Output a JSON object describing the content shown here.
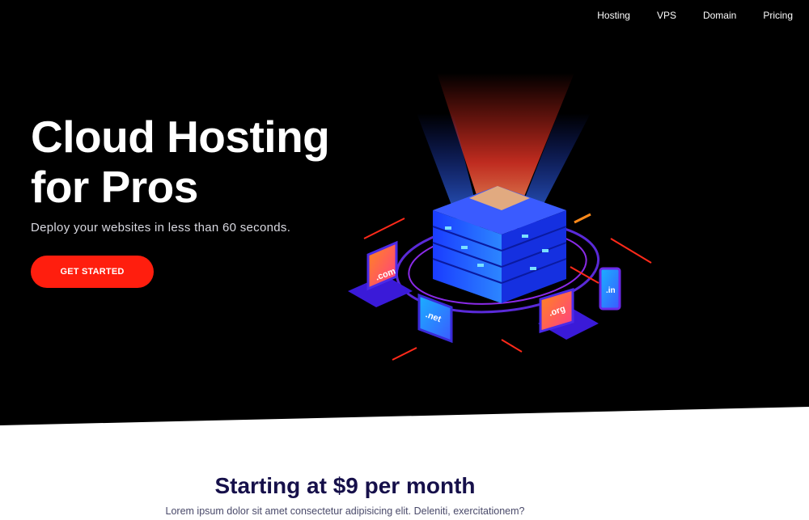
{
  "nav": {
    "items": [
      {
        "label": "Hosting"
      },
      {
        "label": "VPS"
      },
      {
        "label": "Domain"
      },
      {
        "label": "Pricing"
      }
    ]
  },
  "hero": {
    "title_line1": "Cloud Hosting",
    "title_line2": "for Pros",
    "subtitle": "Deploy your websites in less than 60 seconds.",
    "cta_label": "GET STARTED"
  },
  "illustration": {
    "domains": [
      ".com",
      ".net",
      ".org",
      ".in"
    ]
  },
  "pricing": {
    "title": "Starting at $9 per month",
    "description": "Lorem ipsum dolor sit amet consectetur adipisicing elit. Deleniti, exercitationem?"
  },
  "colors": {
    "hero_bg": "#000000",
    "cta": "#ff1e0e",
    "heading_dark": "#16104a"
  }
}
